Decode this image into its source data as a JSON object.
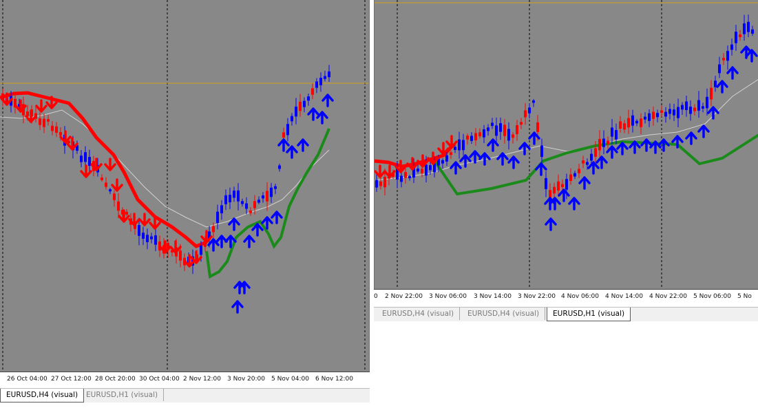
{
  "colors": {
    "plot_bg": "#888888",
    "bull": "#0000ff",
    "bear": "#ff0000",
    "trend_up": "#1a8a1a",
    "trend_down": "#ff0000",
    "ma": "#d2d2d2",
    "price_line": "#d4a017",
    "grid": "#000000"
  },
  "left_window": {
    "time_labels": [
      "26 Oct 04:00",
      "27 Oct 12:00",
      "28 Oct 20:00",
      "30 Oct 04:00",
      "2 Nov 12:00",
      "3 Nov 20:00",
      "5 Nov 04:00",
      "6 Nov 12:00"
    ],
    "tabs": [
      {
        "label": "EURUSD,H4 (visual)",
        "active": true
      },
      {
        "label": "EURUSD,H1 (visual)",
        "active": false
      }
    ]
  },
  "right_window": {
    "time_labels": [
      "0",
      "2 Nov 22:00",
      "3 Nov 06:00",
      "3 Nov 14:00",
      "3 Nov 22:00",
      "4 Nov 06:00",
      "4 Nov 14:00",
      "4 Nov 22:00",
      "5 Nov 06:00",
      "5 No"
    ],
    "tabs": [
      {
        "label": "EURUSD,H4 (visual)",
        "active": false
      },
      {
        "label": "EURUSD,H4 (visual)",
        "active": false
      },
      {
        "label": "EURUSD,H1 (visual)",
        "active": true
      }
    ]
  }
}
